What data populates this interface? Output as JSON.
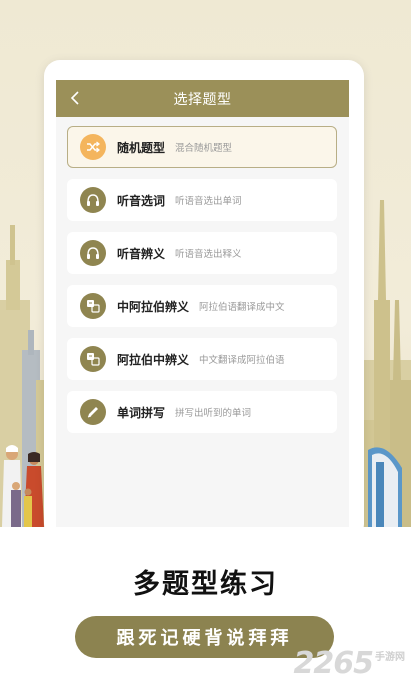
{
  "header": {
    "title": "选择题型",
    "back_icon": "chevron-left-icon"
  },
  "items": [
    {
      "label": "随机题型",
      "desc": "混合随机题型",
      "icon": "shuffle-icon",
      "selected": true
    },
    {
      "label": "听音选词",
      "desc": "听语音选出单词",
      "icon": "headphones-icon",
      "selected": false
    },
    {
      "label": "听音辨义",
      "desc": "听语音选出释义",
      "icon": "headphones-icon",
      "selected": false
    },
    {
      "label": "中阿拉伯辨义",
      "desc": "阿拉伯语翻译成中文",
      "icon": "translate-icon",
      "selected": false
    },
    {
      "label": "阿拉伯中辨义",
      "desc": "中文翻译成阿拉伯语",
      "icon": "translate-icon",
      "selected": false
    },
    {
      "label": "单词拼写",
      "desc": "拼写出听到的单词",
      "icon": "pencil-icon",
      "selected": false
    }
  ],
  "promo": {
    "headline": "多题型练习",
    "slogan": "跟死记硬背说拜拜"
  },
  "watermark": {
    "number": "2265",
    "text": "手游网"
  },
  "colors": {
    "accent": "#9b9059",
    "selected_icon": "#f4b55d",
    "pill": "#8c8350"
  }
}
